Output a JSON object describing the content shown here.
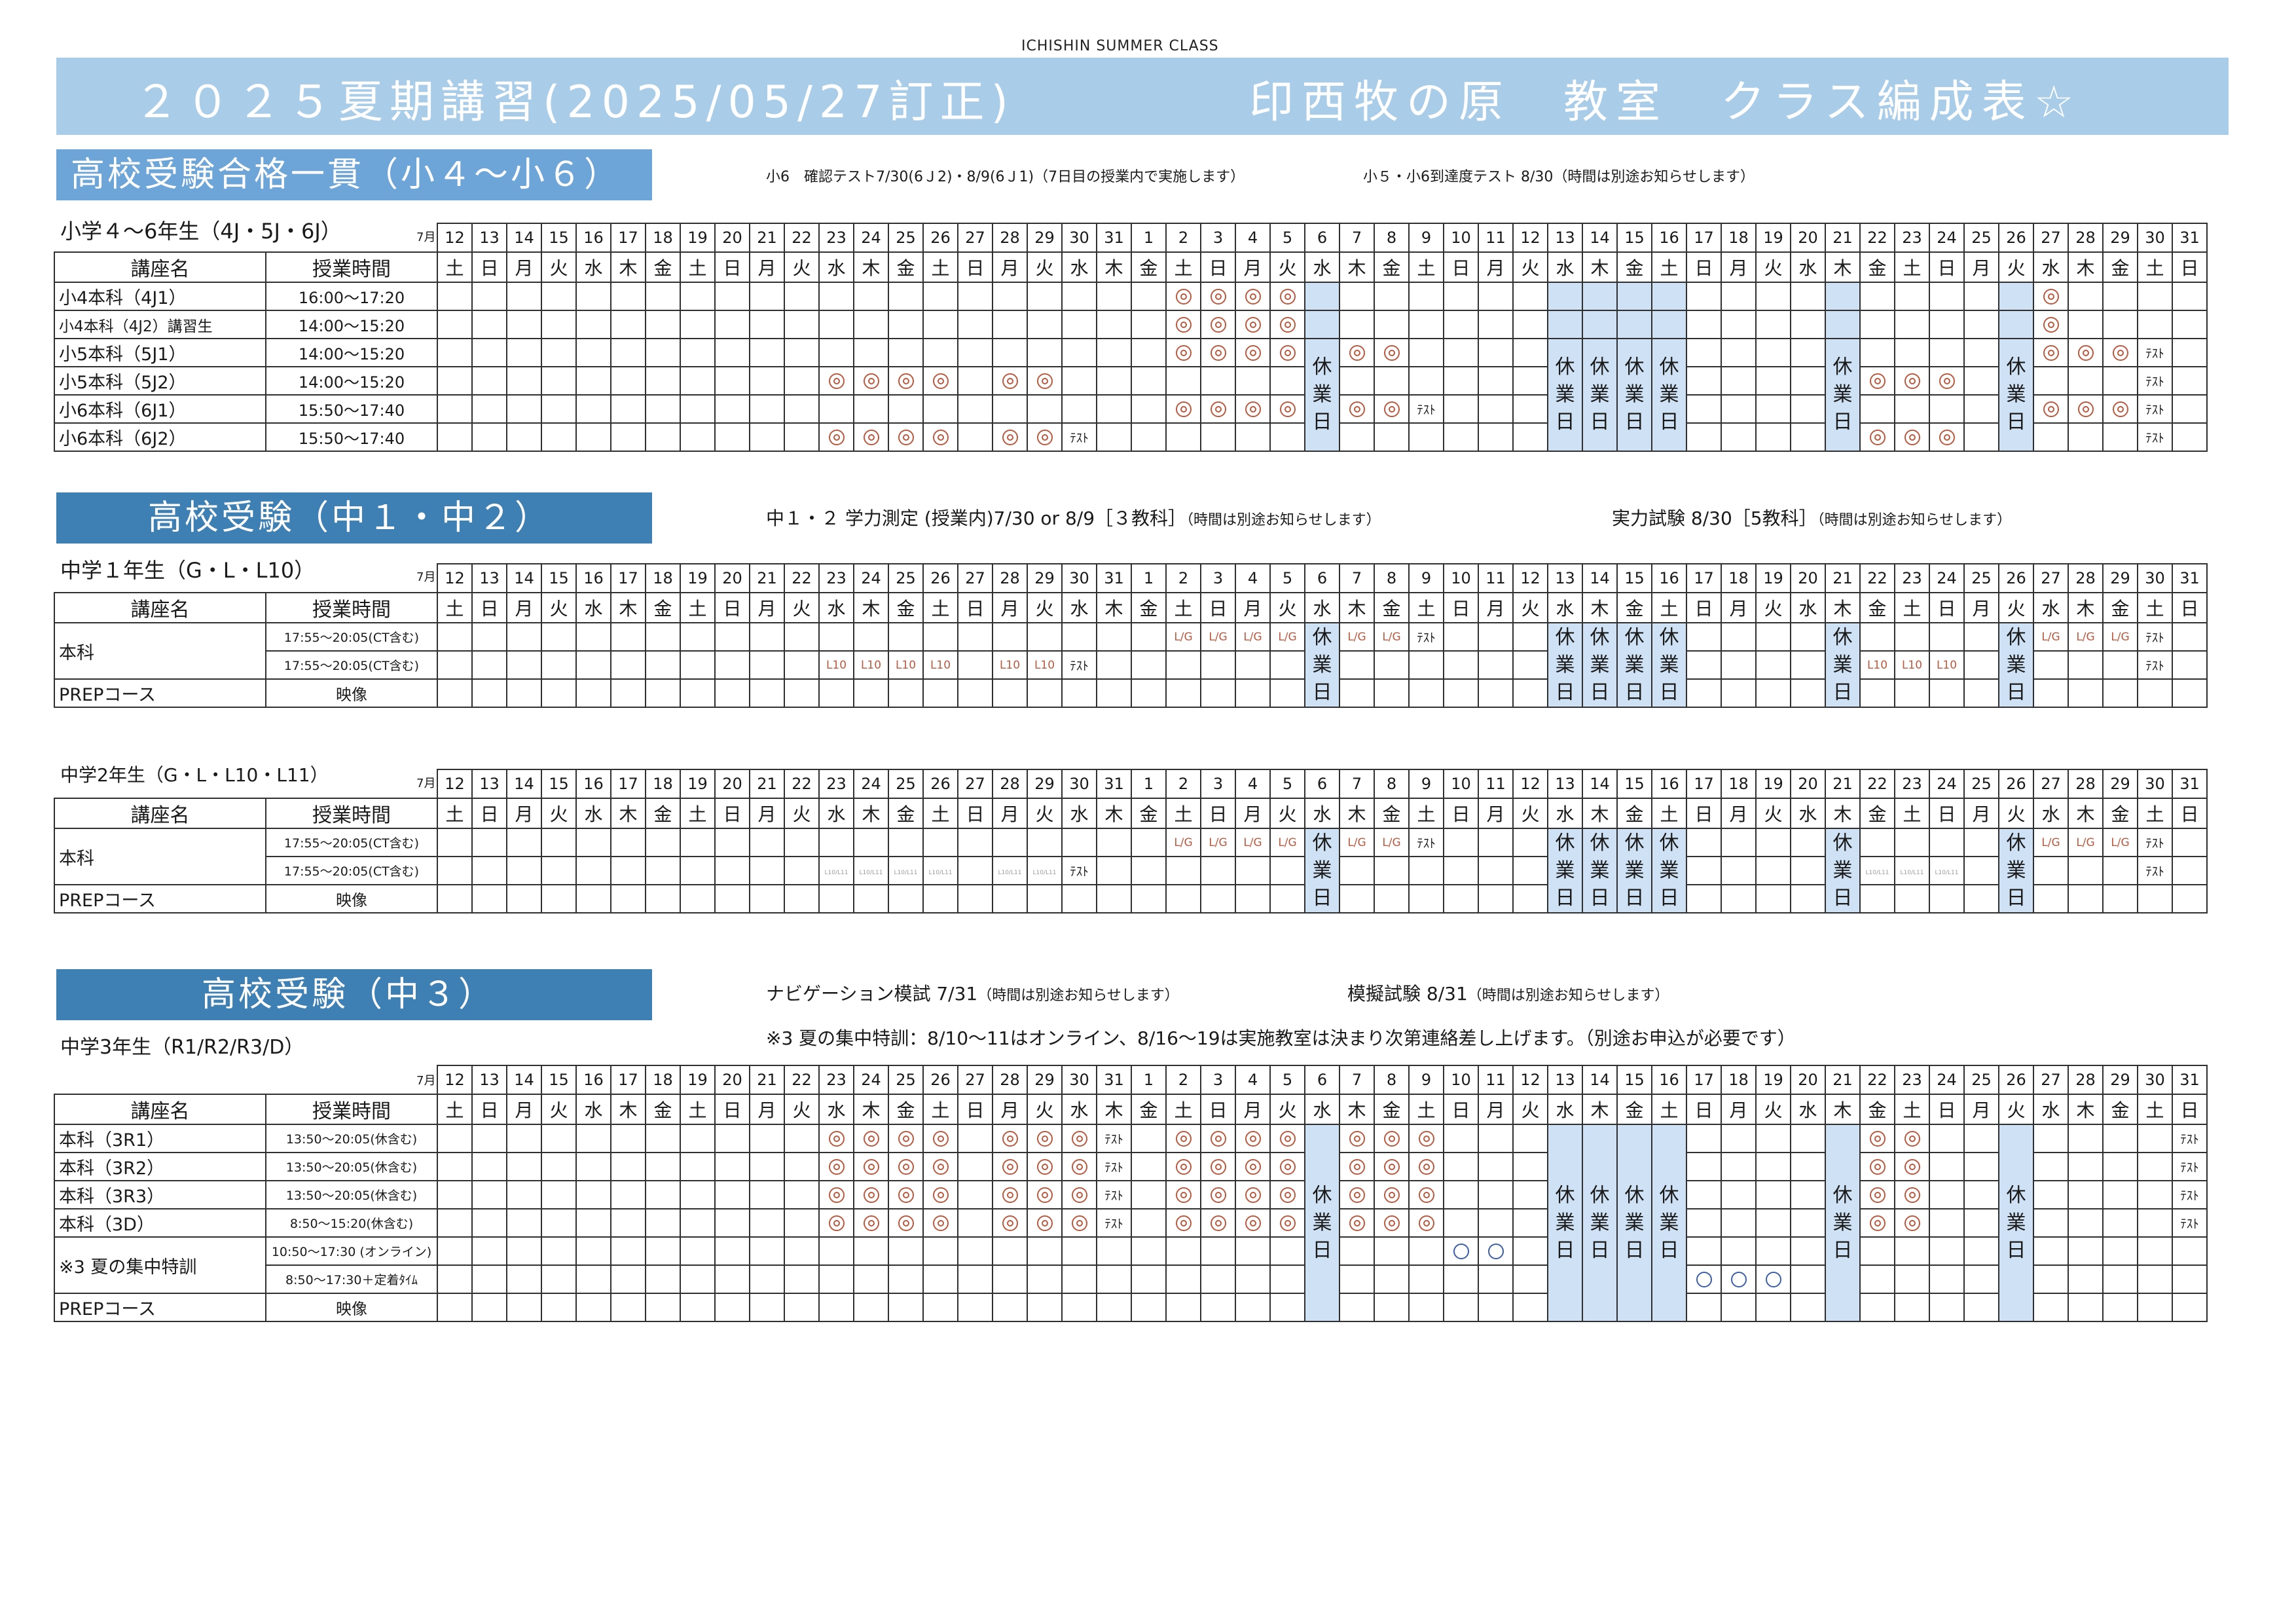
{
  "page": {
    "top_label": "ICHISHIN SUMMER CLASS",
    "title_left": "２０２５夏期講習(2025/05/27訂正)",
    "title_right": "印西牧の原　教室　クラス編成表☆"
  },
  "common": {
    "month": "7月",
    "days": [
      "12",
      "13",
      "14",
      "15",
      "16",
      "17",
      "18",
      "19",
      "20",
      "21",
      "22",
      "23",
      "24",
      "25",
      "26",
      "27",
      "28",
      "29",
      "30",
      "31",
      "1",
      "2",
      "3",
      "4",
      "5",
      "6",
      "7",
      "8",
      "9",
      "10",
      "11",
      "12",
      "13",
      "14",
      "15",
      "16",
      "17",
      "18",
      "19",
      "20",
      "21",
      "22",
      "23",
      "24",
      "25",
      "26",
      "27",
      "28",
      "29",
      "30",
      "31"
    ],
    "weekdays": [
      "土",
      "日",
      "月",
      "火",
      "水",
      "木",
      "金",
      "土",
      "日",
      "月",
      "火",
      "水",
      "木",
      "金",
      "土",
      "日",
      "月",
      "火",
      "水",
      "木",
      "金",
      "土",
      "日",
      "月",
      "火",
      "水",
      "木",
      "金",
      "土",
      "日",
      "月",
      "火",
      "水",
      "木",
      "金",
      "土",
      "日",
      "月",
      "火",
      "水",
      "木",
      "金",
      "土",
      "日",
      "月",
      "火",
      "水",
      "木",
      "金",
      "土",
      "日"
    ],
    "col_course": "講座名",
    "col_time": "授業時間",
    "kyugyo_chars": [
      "休",
      "業",
      "日"
    ]
  },
  "section1": {
    "heading": "高校受験合格一貫（小４～小６）",
    "note1": "小6　確認テスト7/30(6Ｊ2)・8/9(6Ｊ1)（7日目の授業内で実施します）",
    "note2": "小５・小6到達度テスト 8/30（時間は別途お知らせします）",
    "group": "小学４～6年生（4J・5J・6J）",
    "rows": [
      {
        "name": "小4本科（4J1）",
        "time": "16:00～17:20"
      },
      {
        "name": "小4本科（4J2）講習生",
        "time": "14:00～15:20"
      },
      {
        "name": "小5本科（5J1）",
        "time": "14:00～15:20"
      },
      {
        "name": "小5本科（5J2）",
        "time": "14:00～15:20"
      },
      {
        "name": "小6本科（6J1）",
        "time": "15:50～17:40"
      },
      {
        "name": "小6本科（6J2）",
        "time": "15:50～17:40"
      }
    ]
  },
  "section2": {
    "heading": "高校受験（中１・中２）",
    "note1_main": "中１・２ 学力測定 (授業内)7/30 or 8/9［３教科］",
    "note1_sub": "（時間は別途お知らせします）",
    "note2_main": "実力試験 8/30［5教科］",
    "note2_sub": "（時間は別途お知らせします）",
    "group1": {
      "label": "中学１年生（G・L・L10）",
      "main_name": "本科",
      "main_time": "17:55～20:05(CT含む)",
      "prep_name": "PREPコース",
      "prep_time": "映像"
    },
    "group2": {
      "label": "中学2年生（G・L・L10・L11）",
      "main_name": "本科",
      "main_time": "17:55～20:05(CT含む)",
      "prep_name": "PREPコース",
      "prep_time": "映像"
    }
  },
  "section3": {
    "heading": "高校受験（中３）",
    "note1_main": "ナビゲーション模試 7/31",
    "note1_sub": "（時間は別途お知らせします）",
    "note2_main": "模擬試験 8/31",
    "note2_sub": "（時間は別途お知らせします）",
    "note3": "※3 夏の集中特訓：8/10～11はオンライン、8/16～19は実施教室は決まり次第連絡差し上げます。（別途お申込が必要です）",
    "group": "中学3年生（R1/R2/R3/D）",
    "rows": [
      {
        "name": "本科（3R1）",
        "time": "13:50～20:05(休含む)"
      },
      {
        "name": "本科（3R2）",
        "time": "13:50～20:05(休含む)"
      },
      {
        "name": "本科（3R3）",
        "time": "13:50～20:05(休含む)"
      },
      {
        "name": "本科（3D）",
        "time": "8:50～15:20(休含む)"
      },
      {
        "name": "※3 夏の集中特訓",
        "time": "10:50～17:30 (オンライン)"
      },
      {
        "name": "",
        "time": "8:50～17:30＋定着ﾀｲﾑ"
      },
      {
        "name": "PREPコース",
        "time": "映像"
      }
    ]
  },
  "marks": {
    "test": "ﾃｽﾄ",
    "l10": "L10",
    "lg": "L/G",
    "faint": "L10/L11",
    "circle_icon": "double-circle-mark-icon",
    "open_icon": "open-circle-mark-icon"
  },
  "colors": {
    "banner": "#a9cde8",
    "section_light": "#6ea5d8",
    "section_dark": "#3f80b4",
    "holiday": "#cfe1f4",
    "mark": "#b85a3f",
    "open_mark": "#3a5ea8"
  }
}
